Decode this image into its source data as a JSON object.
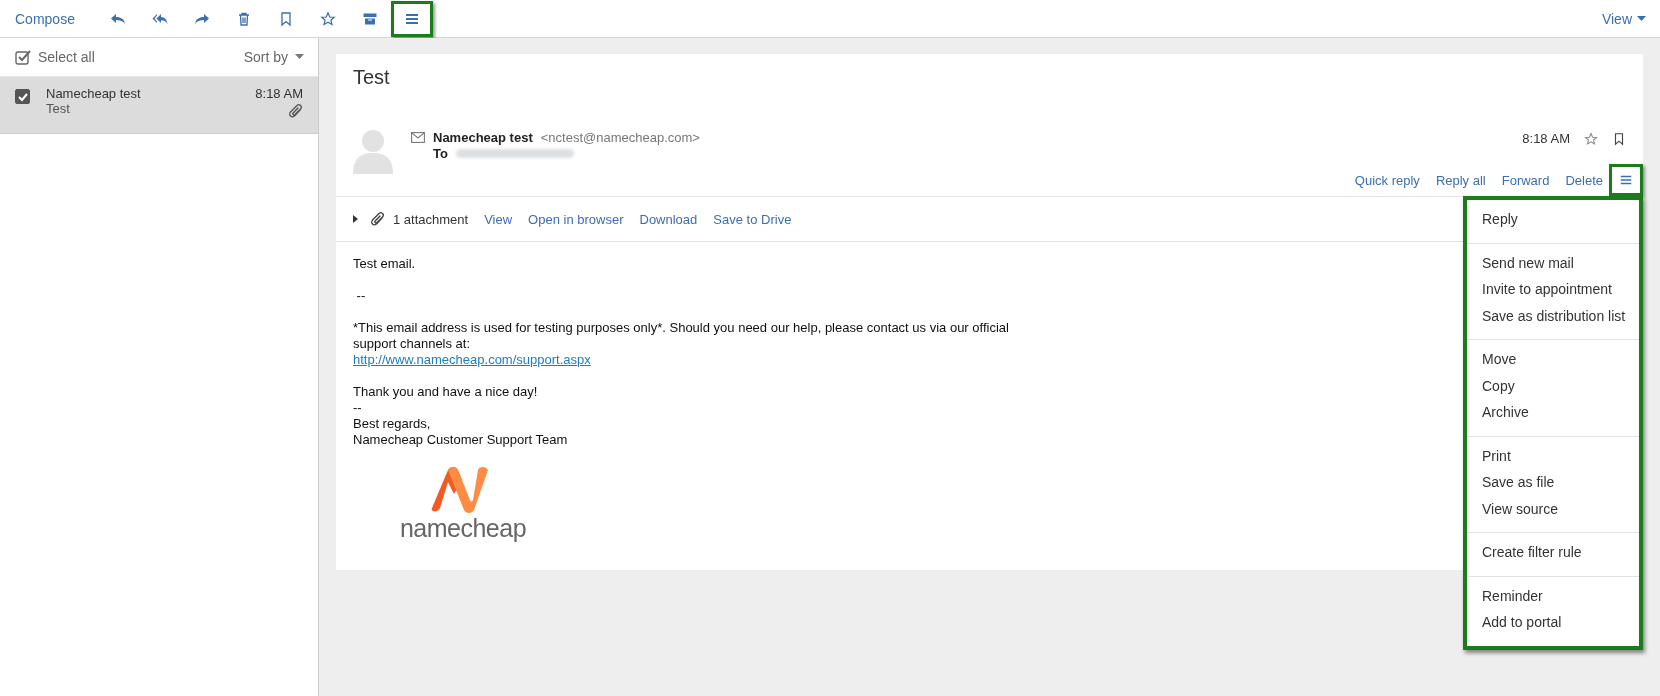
{
  "toolbar": {
    "compose": "Compose",
    "tools": [
      {
        "kind": "reply",
        "highlighted": false
      },
      {
        "kind": "reply-all",
        "highlighted": false
      },
      {
        "kind": "forward",
        "highlighted": false
      },
      {
        "kind": "delete",
        "highlighted": false
      },
      {
        "kind": "flag",
        "highlighted": false
      },
      {
        "kind": "star",
        "highlighted": false
      },
      {
        "kind": "archive",
        "highlighted": false
      },
      {
        "kind": "menu",
        "highlighted": true
      }
    ],
    "view": "View"
  },
  "list_pane": {
    "select_all": {
      "label": "Select all",
      "checked": true
    },
    "sort": "Sort by",
    "messages": [
      {
        "sender": "Namecheap test",
        "subject": "Test",
        "time": "8:18 AM",
        "checked": true,
        "selected": true,
        "attachment": true
      }
    ]
  },
  "message": {
    "subject": "Test",
    "from_name": "Namecheap test",
    "from_address": "<nctest@namecheap.com>",
    "to_label": "To",
    "time": "8:18 AM",
    "actions": [
      "Quick reply",
      "Reply all",
      "Forward",
      "Delete"
    ],
    "more_highlighted": true,
    "attachments": {
      "count": "1 attachment",
      "links": [
        "View",
        "Open in browser",
        "Download",
        "Save to Drive"
      ]
    },
    "body": [
      {
        "lines": [
          "Test email."
        ]
      },
      {
        "lines": [
          " --"
        ]
      },
      {
        "lines": [
          "*This email address is used for testing purposes only*. Should you need our help, please contact us via our official",
          "support channels at:"
        ],
        "link": "http://www.namecheap.com/support.aspx"
      },
      {
        "lines": [
          "Thank you and have a nice day!",
          "--",
          "Best regards,",
          "Namecheap Customer Support Team"
        ]
      }
    ],
    "logo_text": "namecheap"
  },
  "menu": {
    "highlighted": true,
    "groups": [
      [
        "Reply"
      ],
      [
        "Send new mail",
        "Invite to appointment",
        "Save as distribution list"
      ],
      [
        "Move",
        "Copy",
        "Archive"
      ],
      [
        "Print",
        "Save as file",
        "View source"
      ],
      [
        "Create filter rule"
      ],
      [
        "Reminder",
        "Add to portal"
      ]
    ]
  }
}
